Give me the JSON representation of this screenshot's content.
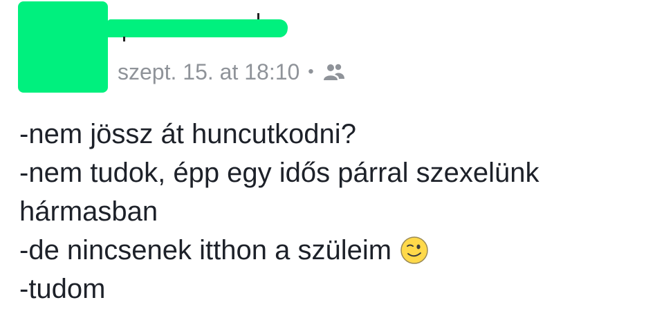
{
  "post": {
    "timestamp": "szept. 15. at 18:10",
    "separator": "•",
    "audience_icon": "friends-icon",
    "lines": [
      "-nem jössz át huncutkodni?",
      "-nem tudok, épp egy idős párral szexelünk",
      "hármasban",
      "-de nincsenek itthon a szüleim",
      "-tudom"
    ],
    "emoji": "wink-emoji-icon"
  },
  "colors": {
    "redaction": "#00f07e",
    "meta_text": "#8f9399",
    "body_text": "#1d2129",
    "emoji_fill": "#ffd94a"
  }
}
